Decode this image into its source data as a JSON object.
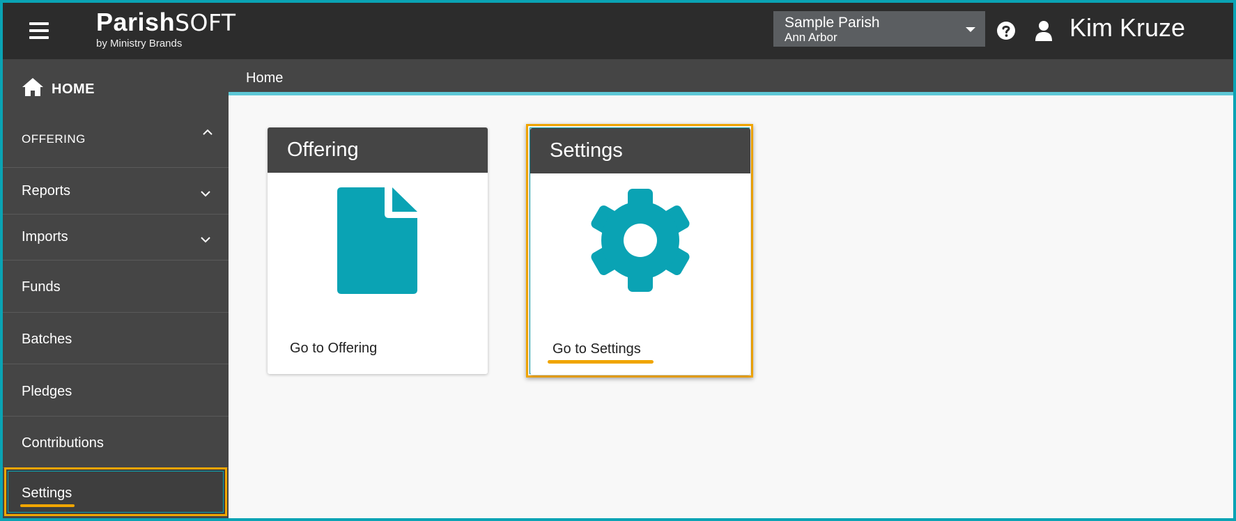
{
  "header": {
    "menu_icon": "hamburger-icon",
    "logo": {
      "main_bold": "Parish",
      "main_light": "SOFT",
      "sub": "by Ministry Brands"
    },
    "parish_selector": {
      "name": "Sample Parish",
      "location": "Ann Arbor"
    },
    "help_icon": "question-circle-icon",
    "user_icon": "user-icon",
    "user_name": "Kim Kruze"
  },
  "sidebar": {
    "home": {
      "label": "HOME",
      "icon": "home-icon"
    },
    "section": {
      "label": "OFFERING",
      "icon": "chevron-up-icon"
    },
    "items": [
      {
        "label": "Reports",
        "expandable": true
      },
      {
        "label": "Imports",
        "expandable": true
      },
      {
        "label": "Funds",
        "expandable": false
      },
      {
        "label": "Batches",
        "expandable": false
      },
      {
        "label": "Pledges",
        "expandable": false
      },
      {
        "label": "Contributions",
        "expandable": false
      },
      {
        "label": "Settings",
        "expandable": false,
        "highlighted": true
      }
    ]
  },
  "breadcrumb": {
    "current": "Home"
  },
  "cards": [
    {
      "title": "Offering",
      "icon": "document-icon",
      "link": "Go to Offering"
    },
    {
      "title": "Settings",
      "icon": "gear-icon",
      "link": "Go to Settings",
      "highlighted": true
    }
  ],
  "colors": {
    "accent": "#0aa3b4",
    "highlight": "#f0a500",
    "topbar": "#2c2c2c",
    "sidebar": "#454545"
  }
}
